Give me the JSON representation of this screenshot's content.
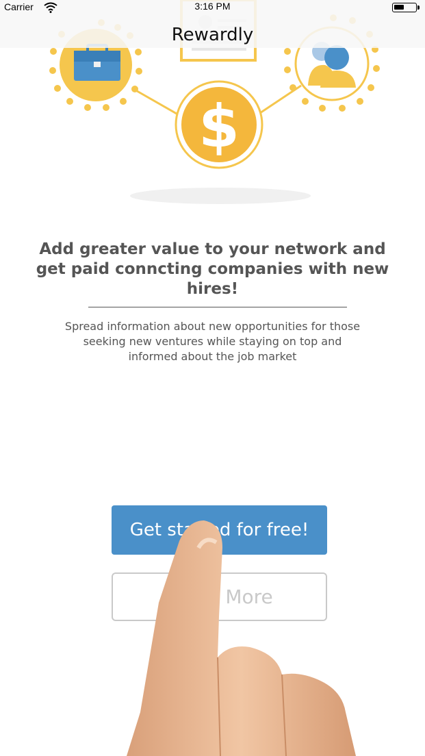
{
  "status_bar": {
    "carrier": "Carrier",
    "time": "3:16 PM"
  },
  "nav": {
    "title": "Rewardly"
  },
  "illustration": {
    "icons": [
      "briefcase-icon",
      "dollar-coin-icon",
      "users-icon",
      "resume-card-icon"
    ],
    "coin_symbol": "$",
    "colors": {
      "accent_yellow": "#f5c64d",
      "coin": "#f4b73c",
      "blue": "#4a90c9"
    }
  },
  "main": {
    "headline": "Add greater value to your network and get paid conncting companies with new hires!",
    "description": "Spread information about new opportunities for those seeking new ventures while staying on top and informed about the job market"
  },
  "buttons": {
    "primary_label": "Get started for free!",
    "secondary_label": "Learn More"
  },
  "colors": {
    "primary_button": "#4a90c9",
    "secondary_border": "#c9c9c9",
    "text": "#555555"
  }
}
